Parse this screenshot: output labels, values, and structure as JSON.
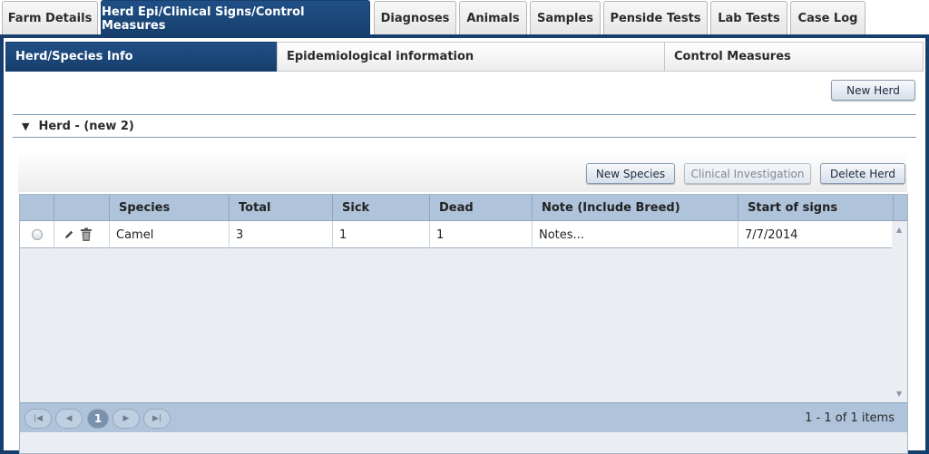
{
  "top_tabs": [
    "Farm Details",
    "Herd Epi/Clinical Signs/Control Measures",
    "Diagnoses",
    "Animals",
    "Samples",
    "Penside Tests",
    "Lab Tests",
    "Case Log"
  ],
  "sub_tabs": [
    "Herd/Species Info",
    "Epidemiological information",
    "Control Measures"
  ],
  "buttons": {
    "new_herd": "New Herd",
    "new_species": "New Species",
    "clinical_investigation": "Clinical Investigation",
    "delete_herd": "Delete Herd"
  },
  "herd": {
    "title": "Herd - (new 2)"
  },
  "grid": {
    "columns": [
      "Species",
      "Total",
      "Sick",
      "Dead",
      "Note (Include Breed)",
      "Start of signs"
    ],
    "rows": [
      {
        "species": "Camel",
        "total": "3",
        "sick": "1",
        "dead": "1",
        "note": "Notes...",
        "start": "7/7/2014"
      }
    ]
  },
  "pager": {
    "current_page": "1",
    "info": "1 - 1 of 1 items"
  },
  "icons": [
    "pencil-icon",
    "trash-icon",
    "first-page-icon",
    "prev-page-icon",
    "next-page-icon",
    "last-page-icon",
    "collapse-triangle-icon",
    "scroll-up-icon",
    "scroll-down-icon"
  ],
  "colors": {
    "primary": "#173f6d",
    "grid_header": "#afc3db"
  }
}
